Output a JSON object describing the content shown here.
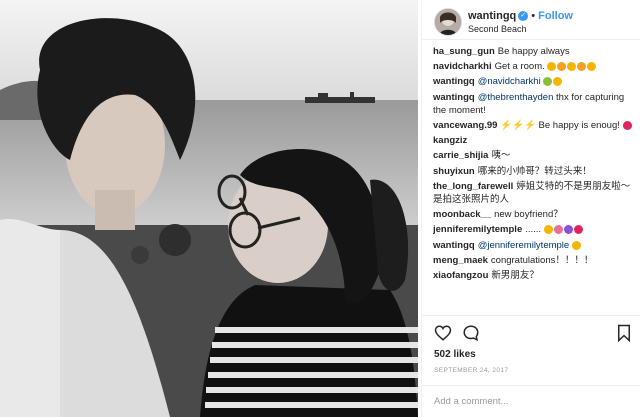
{
  "post": {
    "username": "wantingq",
    "follow_label": "Follow",
    "separator": "•",
    "location": "Second Beach",
    "likes": "502 likes",
    "date": "SEPTEMBER 24, 2017",
    "add_comment_placeholder": "Add a comment..."
  },
  "comments": [
    {
      "user": "ha_sung_gun",
      "text": "Be happy always",
      "mention": "",
      "emojis": []
    },
    {
      "user": "navidcharkhi",
      "text": "Get a room.",
      "mention": "",
      "emojis": [
        "#f4b400",
        "#f4a020",
        "#f4b400",
        "#f4a020",
        "#f4b400"
      ]
    },
    {
      "user": "wantingq",
      "text": "",
      "mention": "@navidcharkhi",
      "emojis": [
        "#8bbf3a",
        "#f4b400"
      ]
    },
    {
      "user": "wantingq",
      "text": "thx for capturing the moment!",
      "mention": "@thebrenthayden",
      "emojis": []
    },
    {
      "user": "vancewang.99",
      "text": "⚡⚡⚡ Be happy is enoug!",
      "mention": "",
      "emojis": [
        "#e0245e"
      ]
    },
    {
      "user": "kangziz",
      "text": "",
      "mention": "",
      "emojis": []
    },
    {
      "user": "carrie_shijia",
      "text": "咦～",
      "mention": "",
      "emojis": []
    },
    {
      "user": "shuyixun",
      "text": "哪来的小帅哥？转过头来！",
      "mention": "",
      "emojis": []
    },
    {
      "user": "the_long_farewell",
      "text": "婷姐艾特的不是男朋友啦～ 是拍这张照片的人",
      "mention": "",
      "emojis": []
    },
    {
      "user": "moonback__",
      "text": "new boyfriend？",
      "mention": "",
      "emojis": []
    },
    {
      "user": "jenniferemilytemple",
      "text": "......",
      "mention": "",
      "emojis": [
        "#f4b400",
        "#e76f9a",
        "#8a4fd6",
        "#e0245e"
      ]
    },
    {
      "user": "wantingq",
      "text": "",
      "mention": "@jenniferemilytemple",
      "emojis": [
        "#f4b400"
      ]
    },
    {
      "user": "meng_maek",
      "text": "congratulations！！！！",
      "mention": "",
      "emojis": []
    },
    {
      "user": "xiaofangzou",
      "text": "新男朋友？",
      "mention": "",
      "emojis": []
    }
  ],
  "icons": {
    "avatar": "avatar-image",
    "verified": "verified-badge-icon",
    "like": "heart-icon",
    "comment": "comment-bubble-icon",
    "save": "bookmark-icon"
  },
  "colors": {
    "accent": "#3897f0",
    "mention": "#003569",
    "muted": "#999999"
  }
}
